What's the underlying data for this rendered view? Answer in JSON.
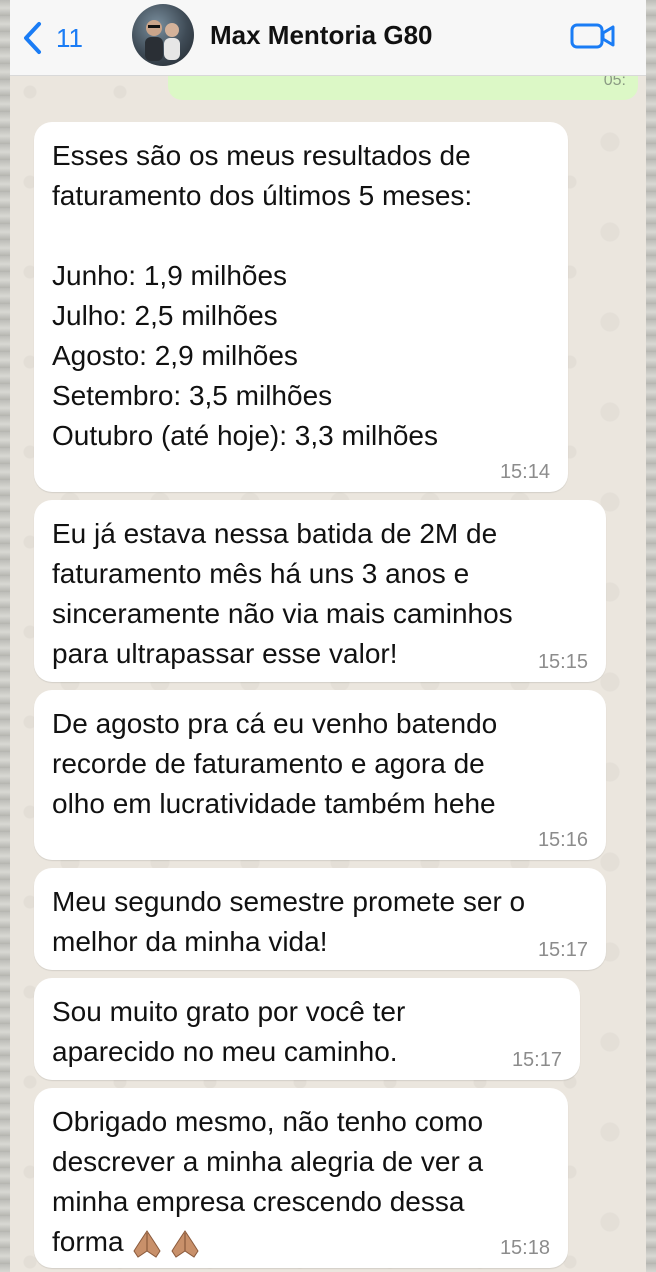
{
  "header": {
    "back_count": "11",
    "title": "Max Mentoria G80"
  },
  "previous_message": {
    "time_fragment": "05:"
  },
  "messages": [
    {
      "text": "Esses são os meus resultados de\nfaturamento dos últimos 5 meses:\n\nJunho: 1,9 milhões\nJulho: 2,5 milhões\nAgosto: 2,9 milhões\nSetembro: 3,5 milhões\nOutubro (até hoje): 3,3 milhões",
      "time": "15:14"
    },
    {
      "text": "Eu já estava nessa batida de 2M de\nfaturamento mês há uns 3 anos e\nsinceramente não via mais caminhos\npara ultrapassar esse valor!",
      "time": "15:15"
    },
    {
      "text": "De agosto pra cá eu venho batendo\nrecorde de faturamento e agora de\nolho em lucratividade também hehe",
      "time": "15:16"
    },
    {
      "text": "Meu segundo semestre promete ser o\nmelhor da minha vida!",
      "time": "15:17"
    },
    {
      "text": "Sou muito grato por você ter\naparecido no meu caminho.",
      "time": "15:17"
    },
    {
      "text": "Obrigado mesmo, não tenho como\ndescrever a minha alegria de ver a\nminha empresa crescendo dessa\nforma",
      "time": "15:18",
      "emoji": "folded-hands-icon"
    }
  ],
  "colors": {
    "accent": "#1a7cf5",
    "bubble_incoming": "#ffffff",
    "bubble_outgoing": "#dcf8c6",
    "chat_background": "#ebe6de"
  }
}
